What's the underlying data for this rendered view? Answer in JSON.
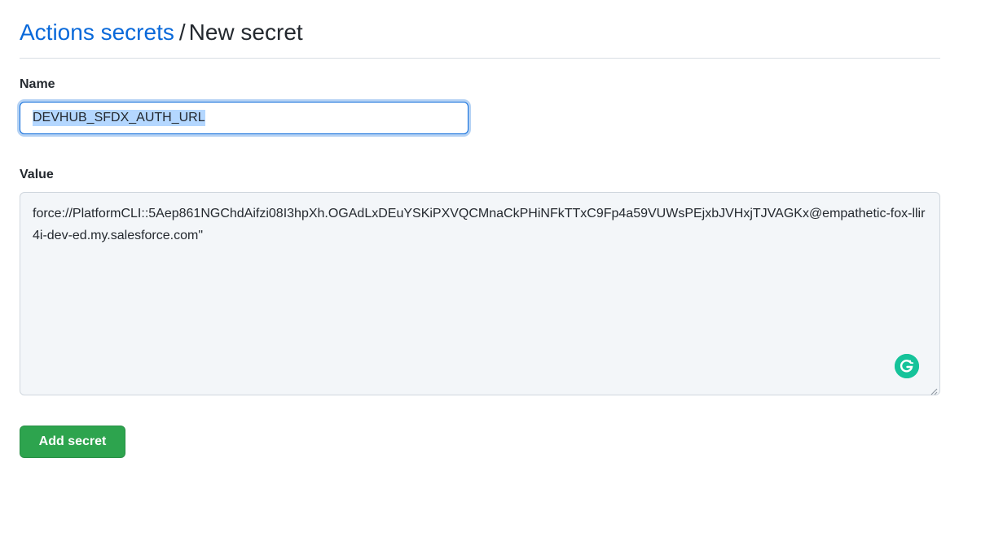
{
  "header": {
    "breadcrumb_link": "Actions secrets",
    "separator": "/",
    "current": "New secret",
    "link_color": "#0969da"
  },
  "form": {
    "name_label": "Name",
    "name_value": "DEVHUB_SFDX_AUTH_URL",
    "value_label": "Value",
    "value_text": "force://PlatformCLI::5Aep861NGChdAifzi08I3hpXh.OGAdLxDEuYSKiPXVQCMnaCkPHiNFkTTxC9Fp4a59VUWsPEjxbJVHxjTJVAGKx@empathetic-fox-llir4i-dev-ed.my.salesforce.com\"",
    "submit_label": "Add secret",
    "submit_color": "#2da44e"
  },
  "icons": {
    "grammarly": "grammarly-icon",
    "resize": "resize-handle-icon"
  }
}
